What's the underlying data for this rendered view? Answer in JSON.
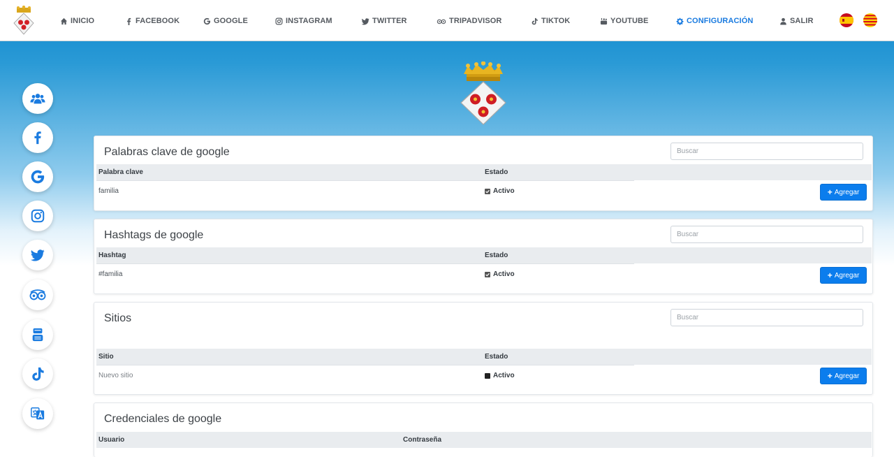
{
  "nav": {
    "items": [
      {
        "key": "inicio",
        "label": "INICIO",
        "icon": "home-icon"
      },
      {
        "key": "facebook",
        "label": "FACEBOOK",
        "icon": "facebook-icon"
      },
      {
        "key": "google",
        "label": "GOOGLE",
        "icon": "google-icon"
      },
      {
        "key": "instagram",
        "label": "INSTAGRAM",
        "icon": "instagram-icon"
      },
      {
        "key": "twitter",
        "label": "TWITTER",
        "icon": "twitter-icon"
      },
      {
        "key": "tripadvisor",
        "label": "TRIPADVISOR",
        "icon": "tripadvisor-icon"
      },
      {
        "key": "tiktok",
        "label": "TIKTOK",
        "icon": "tiktok-icon"
      },
      {
        "key": "youtube",
        "label": "YOUTUBE",
        "icon": "youtube-icon"
      },
      {
        "key": "configuracion",
        "label": "CONFIGURACIÓN",
        "icon": "gear-icon",
        "active": true
      },
      {
        "key": "salir",
        "label": "SALIR",
        "icon": "user-icon"
      }
    ],
    "languages": [
      "spanish-flag-icon",
      "catalan-flag-icon"
    ]
  },
  "colors": {
    "accent": "#1a7be0",
    "button": "#0b7ded",
    "header_bg": "#0d86cc"
  },
  "sidebar": {
    "items": [
      "users-icon",
      "facebook-icon",
      "google-icon",
      "instagram-icon",
      "twitter-icon",
      "tripadvisor-icon",
      "youtube-icon",
      "tiktok-icon",
      "translate-icon"
    ]
  },
  "keywords": {
    "title": "Palabras clave de google",
    "search_placeholder": "Buscar",
    "col_1": "Palabra clave",
    "col_2": "Estado",
    "row_value": "familia",
    "row_status": "Activo",
    "add_label": "Agregar"
  },
  "hashtags": {
    "title": "Hashtags de google",
    "search_placeholder": "Buscar",
    "col_1": "Hashtag",
    "col_2": "Estado",
    "row_value": "#familia",
    "row_status": "Activo",
    "add_label": "Agregar"
  },
  "sites": {
    "title": "Sitios",
    "search_placeholder": "Buscar",
    "col_1": "Sitio",
    "col_2": "Estado",
    "row_placeholder": "Nuevo sitio",
    "row_status": "Activo",
    "add_label": "Agregar"
  },
  "credentials": {
    "title": "Credenciales de google",
    "col_1": "Usuario",
    "col_2": "Contraseña"
  }
}
